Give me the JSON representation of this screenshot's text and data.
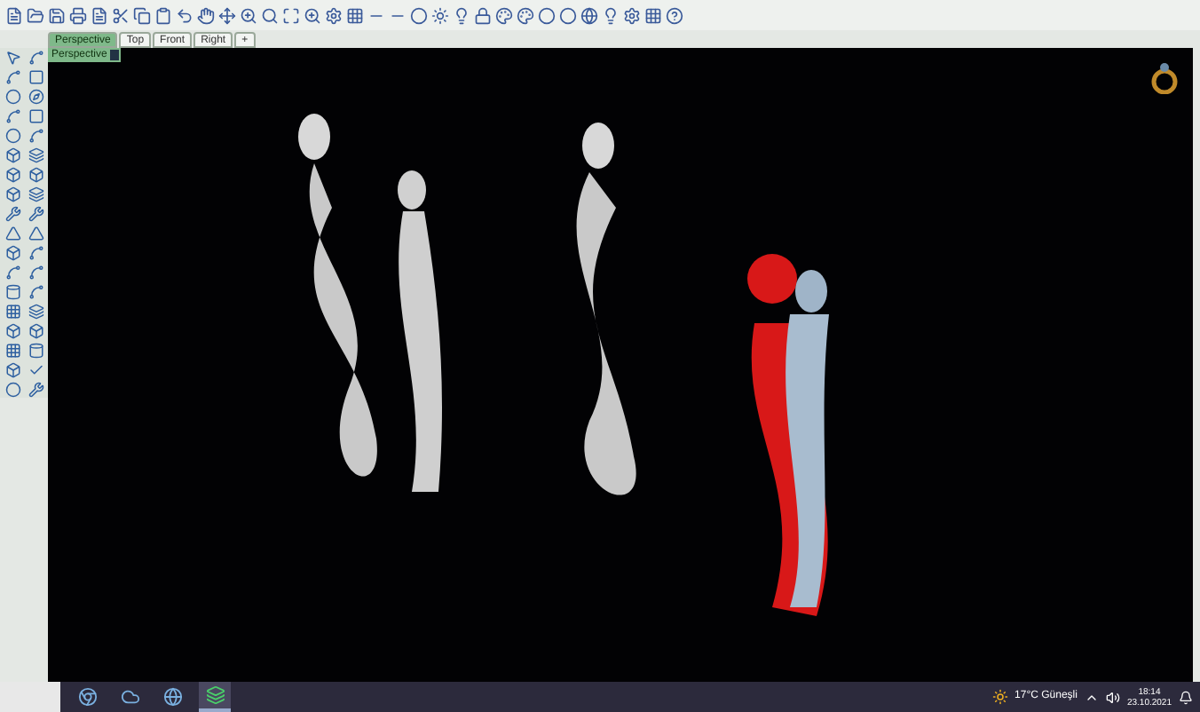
{
  "tabs": [
    {
      "label": "Perspective",
      "selected": true
    },
    {
      "label": "Top",
      "selected": false
    },
    {
      "label": "Front",
      "selected": false
    },
    {
      "label": "Right",
      "selected": false
    },
    {
      "label": "+",
      "selected": false
    }
  ],
  "viewport": {
    "label": "Perspective"
  },
  "taskbar": {
    "apps": [
      {
        "selected": false
      },
      {
        "selected": false
      },
      {
        "selected": false
      },
      {
        "selected": true
      }
    ],
    "weather": "17°C Güneşli",
    "time": "18:14",
    "date": "23.10.2021"
  }
}
